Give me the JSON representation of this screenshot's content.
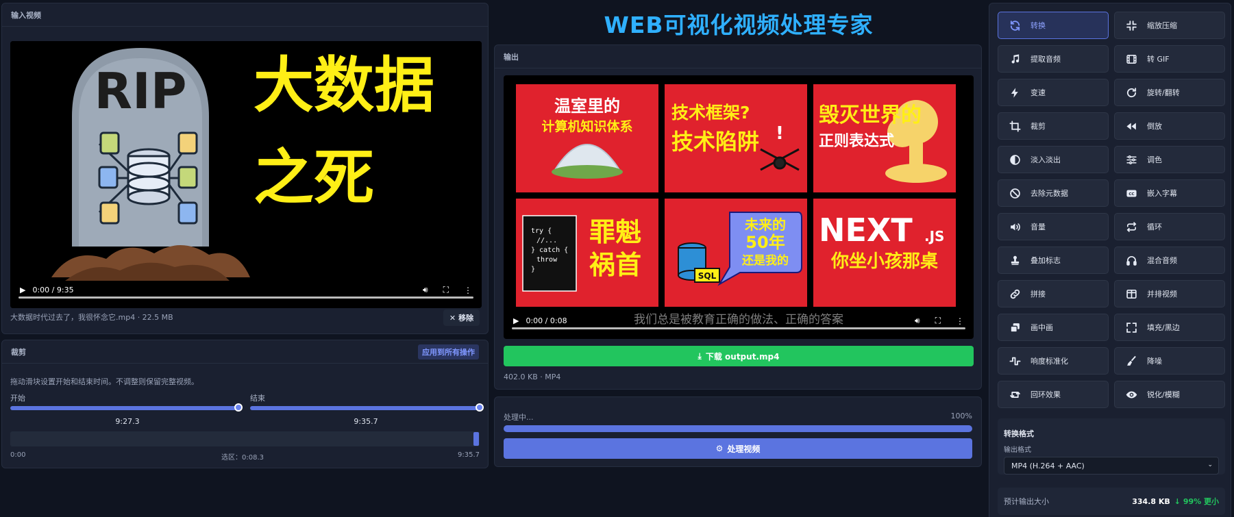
{
  "app": {
    "title": "WEB可视化视频处理专家"
  },
  "input": {
    "header": "输入视频",
    "video": {
      "thumb_text_1": "大数据",
      "thumb_text_2": "之死",
      "tombstone_text": "RIP",
      "time": "0:00 / 9:35"
    },
    "file_info": "大数据时代过去了，我很怀念它.mp4 · 22.5 MB",
    "remove_label": "移除"
  },
  "trim": {
    "header": "裁剪",
    "apply_all": "应用到所有操作",
    "description": "拖动滑块设置开始和结束时间。不调整则保留完整视频。",
    "start_label": "开始",
    "end_label": "结束",
    "start_value": "9:27.3",
    "end_value": "9:35.7",
    "range_start": "0:00",
    "range_end": "9:35.7",
    "selection": "选区：0:08.3"
  },
  "output": {
    "header": "输出",
    "video": {
      "time": "0:00 / 0:08",
      "subtitle": "我们总是被教育正确的做法、正确的答案",
      "tiles": {
        "t1a": "温室里的",
        "t1b": "计算机知识体系",
        "t2a": "技术框架?",
        "t2b": "技术陷阱",
        "t3a": "毁灭世界的",
        "t3b": "正则表达式",
        "t4code": "try {\n  //...\n} catch {\n  throw\n}",
        "t4a": "罪魁",
        "t4b": "祸首",
        "t5a": "未来的",
        "t5b": "50年",
        "t5c": "还是我的",
        "t5sql": "SQL",
        "t6a": "NEXT",
        "t6js": ".JS",
        "t6b": "你坐小孩那桌"
      }
    },
    "download_label": "下载 output.mp4",
    "meta": "402.0 KB · MP4"
  },
  "process": {
    "status": "处理中...",
    "percent": "100%",
    "progress": 1.0,
    "button_label": "处理视频"
  },
  "operations": [
    {
      "label": "转换",
      "icon": "refresh-icon",
      "active": true
    },
    {
      "label": "缩放压缩",
      "icon": "compress-icon",
      "active": false
    },
    {
      "label": "提取音频",
      "icon": "music-note-icon",
      "active": false
    },
    {
      "label": "转 GIF",
      "icon": "film-icon",
      "active": false
    },
    {
      "label": "变速",
      "icon": "lightning-icon",
      "active": false
    },
    {
      "label": "旋转/翻转",
      "icon": "rotate-icon",
      "active": false
    },
    {
      "label": "裁剪",
      "icon": "crop-icon",
      "active": false
    },
    {
      "label": "倒放",
      "icon": "rewind-icon",
      "active": false
    },
    {
      "label": "淡入淡出",
      "icon": "half-circle-icon",
      "active": false
    },
    {
      "label": "调色",
      "icon": "sliders-icon",
      "active": false
    },
    {
      "label": "去除元数据",
      "icon": "ban-icon",
      "active": false
    },
    {
      "label": "嵌入字幕",
      "icon": "cc-icon",
      "active": false
    },
    {
      "label": "音量",
      "icon": "volume-icon",
      "active": false
    },
    {
      "label": "循环",
      "icon": "loop-icon",
      "active": false
    },
    {
      "label": "叠加标志",
      "icon": "stamp-icon",
      "active": false
    },
    {
      "label": "混合音频",
      "icon": "headphones-icon",
      "active": false
    },
    {
      "label": "拼接",
      "icon": "link-icon",
      "active": false
    },
    {
      "label": "并排视频",
      "icon": "columns-icon",
      "active": false
    },
    {
      "label": "画中画",
      "icon": "pip-icon",
      "active": false
    },
    {
      "label": "填充/黑边",
      "icon": "expand-icon",
      "active": false
    },
    {
      "label": "响度标准化",
      "icon": "waveform-icon",
      "active": false
    },
    {
      "label": "降噪",
      "icon": "broom-icon",
      "active": false
    },
    {
      "label": "回环效果",
      "icon": "retweet-icon",
      "active": false
    },
    {
      "label": "锐化/模糊",
      "icon": "eye-icon",
      "active": false
    }
  ],
  "format": {
    "title": "转换格式",
    "label": "输出格式",
    "selected": "MP4 (H.264 + AAC)"
  },
  "estimate": {
    "label": "预计输出大小",
    "value": "334.8 KB",
    "reduction": "↓ 99% 更小"
  },
  "colors": {
    "accent": "#5b74e0",
    "title_blue": "#2fb0ff",
    "success": "#22c55e",
    "thumb_red": "#e0222d",
    "thumb_yellow": "#ffef16"
  }
}
